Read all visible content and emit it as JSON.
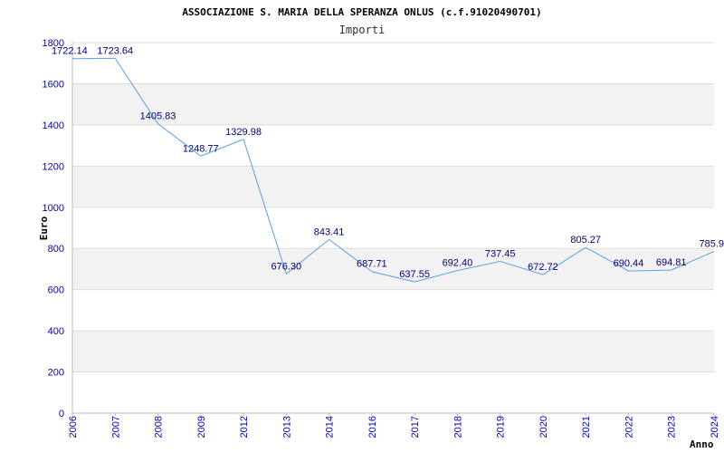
{
  "chart_data": {
    "type": "line",
    "title": "ASSOCIAZIONE S. MARIA DELLA SPERANZA ONLUS (c.f.91020490701)",
    "subtitle": "Importi",
    "xlabel": "Anno",
    "ylabel": "Euro",
    "ylim": [
      0,
      1800
    ],
    "yticks": [
      0,
      200,
      400,
      600,
      800,
      1000,
      1200,
      1400,
      1600,
      1800
    ],
    "categories": [
      "2006",
      "2007",
      "2008",
      "2009",
      "2012",
      "2013",
      "2014",
      "2016",
      "2017",
      "2018",
      "2019",
      "2020",
      "2021",
      "2022",
      "2023",
      "2024"
    ],
    "values": [
      1722.14,
      1723.64,
      1405.83,
      1248.77,
      1329.98,
      676.3,
      843.41,
      687.71,
      637.55,
      692.4,
      737.45,
      672.72,
      805.27,
      690.44,
      694.81,
      785.9
    ],
    "data_labels": [
      "1722.14",
      "1723.64",
      "1405.83",
      "1248.77",
      "1329.98",
      "676.30",
      "843.41",
      "687.71",
      "637.55",
      "692.40",
      "737.45",
      "672.72",
      "805.27",
      "690.44",
      "694.81",
      "785.9"
    ],
    "grid": true,
    "band_color": "#f2f2f2",
    "line_color": "#5aa0e6",
    "tick_color": "#0000cc",
    "label_color": "#000080"
  }
}
